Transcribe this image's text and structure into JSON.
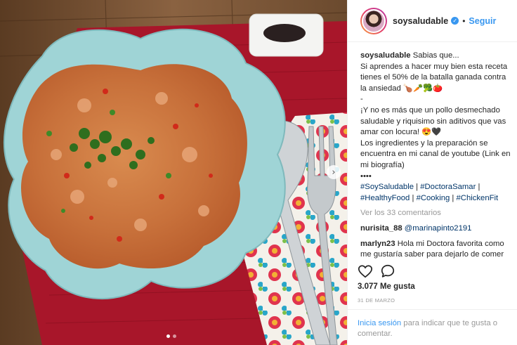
{
  "post": {
    "username": "soysaludable",
    "follow_label": "Seguir",
    "caption_lines": [
      "Sabias que...",
      "Si aprendes a hacer muy bien esta receta tienes el 50% de la batalla ganada contra la ansiedad 🍗🥕🥦🍅",
      "-",
      "¡Y no es más que un pollo desmechado saludable y riquisimo sin aditivos que vas amar con locura! 😍🖤",
      "Los ingredientes y la preparación se encuentra en mi canal de youtube (Link en mi biografía)",
      "••••"
    ],
    "hashtags": [
      "#SoySaludable",
      "#DoctoraSamar",
      "#HealthyFood",
      "#Cooking",
      "#ChickenFit"
    ],
    "view_comments": "Ver los 33 comentarios",
    "comments": [
      {
        "user": "nurisita_88",
        "mention": "@marinapinto2191",
        "text": ""
      },
      {
        "user": "marlyn23",
        "mention": "",
        "text": "Hola mi Doctora favorita como me gustaría saber para dejarlo de comer"
      }
    ],
    "likes": "3.077 Me gusta",
    "date": "31 DE MARZO",
    "login_link": "Inicia sesión",
    "login_text": " para indicar que te gusta o comentar."
  },
  "icons": {
    "verified": "verified-badge-icon",
    "like": "heart-icon",
    "comment": "speech-bubble-icon",
    "next": "chevron-right-icon"
  },
  "colors": {
    "link_blue": "#3897f0",
    "hashtag_blue": "#003569",
    "muted_gray": "#999999",
    "text": "#262626"
  }
}
